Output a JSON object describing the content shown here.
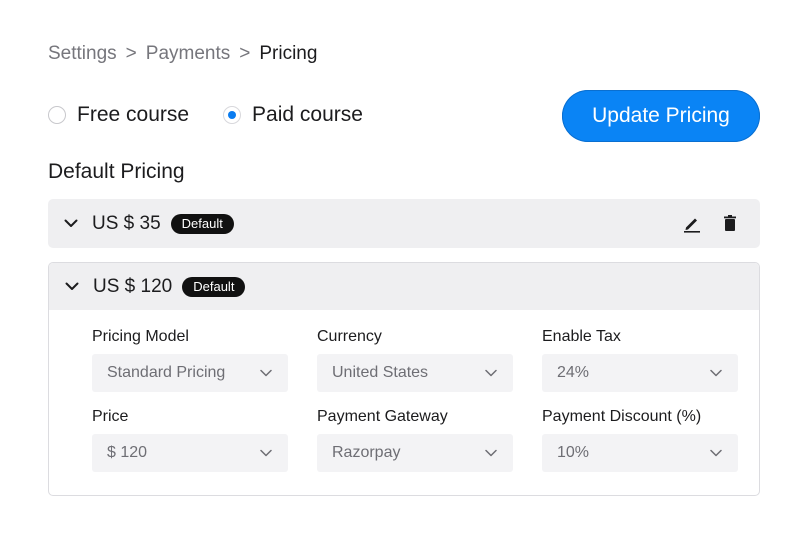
{
  "breadcrumb": {
    "items": [
      "Settings",
      "Payments",
      "Pricing"
    ],
    "separator": ">"
  },
  "course_type": {
    "options": [
      {
        "label": "Free course",
        "checked": false
      },
      {
        "label": "Paid course",
        "checked": true
      }
    ]
  },
  "update_button": {
    "label": "Update Pricing"
  },
  "section": {
    "title": "Default Pricing"
  },
  "prices": [
    {
      "label": "US $ 35",
      "badge": "Default",
      "expanded": false
    },
    {
      "label": "US $ 120",
      "badge": "Default",
      "expanded": true
    }
  ],
  "form": {
    "pricing_model": {
      "label": "Pricing Model",
      "value": "Standard Pricing"
    },
    "currency": {
      "label": "Currency",
      "value": "United States"
    },
    "enable_tax": {
      "label": "Enable Tax",
      "value": "24%"
    },
    "price": {
      "label": "Price",
      "value": "$ 120"
    },
    "payment_gateway": {
      "label": "Payment Gateway",
      "value": "Razorpay"
    },
    "payment_discount": {
      "label": "Payment Discount (%)",
      "value": "10%"
    }
  },
  "icons": {
    "edit": "pencil-icon",
    "delete": "trash-icon",
    "expand": "chevron-down-icon",
    "dropdown": "chevron-down-icon"
  },
  "colors": {
    "accent": "#0a84f5",
    "badge_bg": "#111111",
    "row_bg": "#efeff1"
  }
}
